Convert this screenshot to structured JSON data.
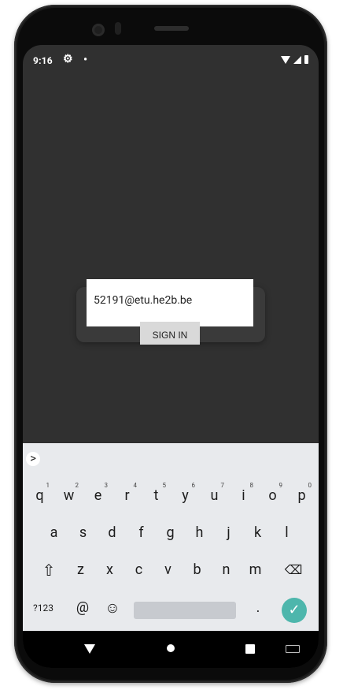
{
  "statusbar": {
    "time": "9:16",
    "gear_icon": "⚙",
    "dot_icon": "•"
  },
  "login": {
    "email_value": "52191@etu.he2b.be",
    "sign_in_label": "SIGN IN"
  },
  "keyboard": {
    "row1": [
      {
        "key": "q",
        "hint": "1"
      },
      {
        "key": "w",
        "hint": "2"
      },
      {
        "key": "e",
        "hint": "3"
      },
      {
        "key": "r",
        "hint": "4"
      },
      {
        "key": "t",
        "hint": "5"
      },
      {
        "key": "y",
        "hint": "6"
      },
      {
        "key": "u",
        "hint": "7"
      },
      {
        "key": "i",
        "hint": "8"
      },
      {
        "key": "o",
        "hint": "9"
      },
      {
        "key": "p",
        "hint": "0"
      }
    ],
    "row2": [
      "a",
      "s",
      "d",
      "f",
      "g",
      "h",
      "j",
      "k",
      "l"
    ],
    "row3": [
      "⇧",
      "z",
      "x",
      "c",
      "v",
      "b",
      "n",
      "m",
      "⌫"
    ],
    "row4": [
      "?123",
      "@",
      "☺",
      ".",
      "✓"
    ],
    "suggest_toggle": ">",
    "colors": {
      "background": "#e8eaed",
      "enter": "#4db6ac"
    }
  }
}
